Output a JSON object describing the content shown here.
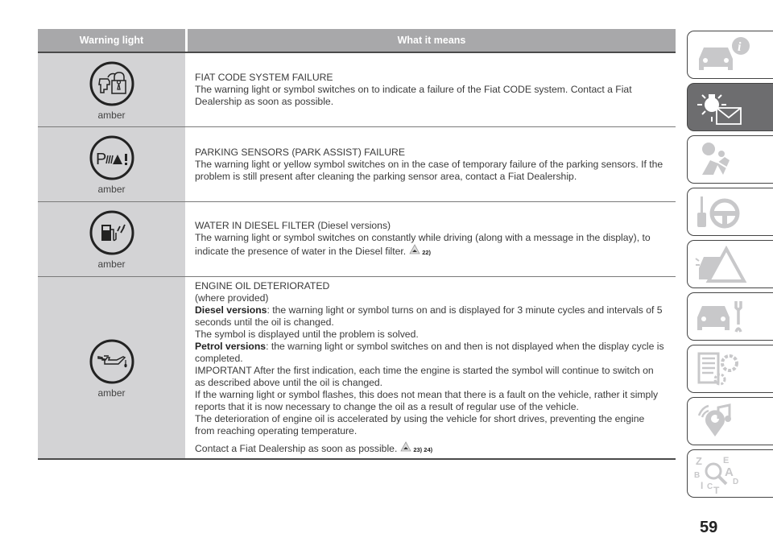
{
  "table": {
    "headers": {
      "warning_light": "Warning light",
      "what_it_means": "What it means"
    },
    "rows": [
      {
        "icon": "fiat-code-lock-icon",
        "color_label": "amber",
        "title": "FIAT CODE SYSTEM FAILURE",
        "lines": [
          "The warning light or symbol switches on to indicate a failure of the Fiat CODE system. Contact a Fiat Dealership as soon as possible."
        ]
      },
      {
        "icon": "park-assist-failure-icon",
        "color_label": "amber",
        "title": "PARKING SENSORS (PARK ASSIST) FAILURE",
        "lines": [
          "The warning light or yellow symbol switches on in the case of temporary failure of the parking sensors. If the problem is still present after cleaning the parking sensor area, contact a Fiat Dealership."
        ]
      },
      {
        "icon": "water-in-diesel-filter-icon",
        "color_label": "amber",
        "title": "WATER IN DIESEL FILTER (Diesel versions)",
        "lines": [
          "The warning light or symbol switches on constantly while driving (along with a message in the display), to indicate the presence of water in the Diesel filter."
        ],
        "refs": "22)"
      },
      {
        "icon": "engine-oil-icon",
        "color_label": "amber",
        "title": "ENGINE OIL DETERIORATED",
        "subtitle": "(where provided)",
        "diesel_label": "Diesel versions",
        "diesel_text": ": the warning light or symbol turns on and is displayed for 3 minute cycles and intervals of 5 seconds until the oil is changed.",
        "symbol_text": "The symbol is displayed until the problem is solved.",
        "petrol_label": "Petrol versions",
        "petrol_text": ": the warning light or symbol switches on and then is not displayed when the display cycle is completed.",
        "important_text": "IMPORTANT After the first indication, each time the engine is started the symbol will continue to switch on as described above until the oil is changed.",
        "flash_text": "If the warning light or symbol flashes, this does not mean that there is a fault on the vehicle, rather it simply reports that it is now necessary to change the oil as a result of regular use of the vehicle.",
        "deterioration_text": "The deterioration of engine oil is accelerated by using the vehicle for short drives, preventing the engine from reaching operating temperature.",
        "contact_text": "Contact a Fiat Dealership as soon as possible.",
        "refs": "23) 24)"
      }
    ]
  },
  "sidebar": {
    "tabs": [
      {
        "name": "knowing-your-car",
        "icon": "car-info-icon",
        "active": false
      },
      {
        "name": "warning-lights-messages",
        "icon": "warning-light-message-icon",
        "active": true
      },
      {
        "name": "safety",
        "icon": "airbag-seatbelt-icon",
        "active": false
      },
      {
        "name": "starting-driving",
        "icon": "key-steering-wheel-icon",
        "active": false
      },
      {
        "name": "in-an-emergency",
        "icon": "car-warning-triangle-icon",
        "active": false
      },
      {
        "name": "servicing-care",
        "icon": "car-wrench-icon",
        "active": false
      },
      {
        "name": "technical-data",
        "icon": "document-gears-icon",
        "active": false
      },
      {
        "name": "multimedia",
        "icon": "multimedia-note-icon",
        "active": false
      },
      {
        "name": "index",
        "icon": "index-search-icon",
        "active": false
      }
    ]
  },
  "page_number": "59",
  "colors": {
    "header_bg": "#a8a8aa",
    "icon_cell_bg": "#d3d3d5",
    "active_tab_bg": "#6d6d6f"
  }
}
